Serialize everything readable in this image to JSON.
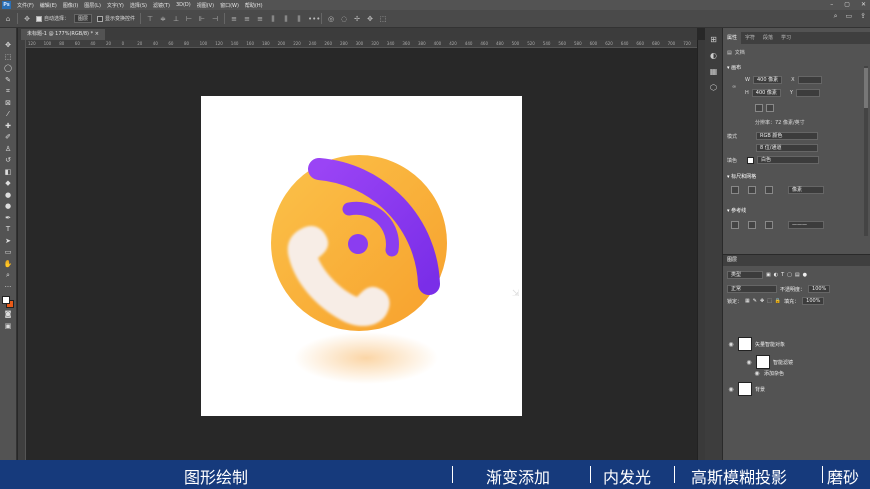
{
  "menubar": {
    "logo": "Ps",
    "items": [
      "文件(F)",
      "编辑(E)",
      "图像(I)",
      "图层(L)",
      "文字(Y)",
      "选择(S)",
      "滤镜(T)",
      "3D(D)",
      "视图(V)",
      "窗口(W)",
      "帮助(H)"
    ]
  },
  "optbar": {
    "auto_select_label": "自动选择：",
    "auto_select_value": "图层",
    "show_transform": "显示变换控件"
  },
  "document": {
    "tab_label": "未标题-1 @ 177%(RGB/8) *"
  },
  "ruler": {
    "ticks": [
      "120",
      "100",
      "80",
      "60",
      "40",
      "20",
      "0",
      "20",
      "40",
      "60",
      "80",
      "100",
      "120",
      "140",
      "160",
      "180",
      "200",
      "220",
      "240",
      "260",
      "280",
      "300",
      "320",
      "340",
      "360",
      "380",
      "400",
      "420",
      "440",
      "460",
      "480",
      "500",
      "520",
      "540",
      "560",
      "580",
      "600",
      "620",
      "640",
      "660",
      "680",
      "700",
      "720"
    ]
  },
  "properties": {
    "tabs": [
      "属性",
      "字符",
      "段落",
      "学习"
    ],
    "doc_label": "文档",
    "canvas_section": "画布",
    "w_label": "W",
    "w_value": "400 像素",
    "h_label": "H",
    "h_value": "400 像素",
    "x_label": "X",
    "y_label": "Y",
    "resolution": "分辨率：72 像素/英寸",
    "mode_label": "模式",
    "mode_value": "RGB 颜色",
    "depth_value": "8 位/通道",
    "fill_label": "填色",
    "fill_value": "白色",
    "rulers_section": "标尺和网格",
    "units_value": "像素",
    "guides_section": "参考线"
  },
  "layers": {
    "tab": "图层",
    "kind_value": "类型",
    "blend_value": "正常",
    "opacity_label": "不透明度：",
    "opacity_value": "100%",
    "lock_label": "锁定：",
    "fill_label": "填充：",
    "fill_value": "100%",
    "items": [
      {
        "name": "矢量智能对象"
      },
      {
        "name": "智能滤镜"
      },
      {
        "name": "添加杂色"
      },
      {
        "name": "背景"
      }
    ]
  },
  "caption": {
    "items": [
      "图形绘制",
      "渐变添加",
      "内发光",
      "高斯模糊投影",
      "磨砂"
    ]
  },
  "colors": {
    "accent_purple": "#8a3cf0",
    "accent_orange": "#f7a530",
    "caption_bg": "#163a7c"
  }
}
